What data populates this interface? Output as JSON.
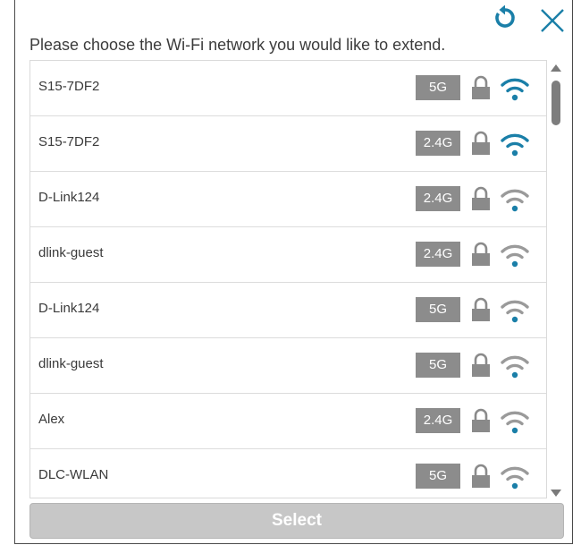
{
  "dialog": {
    "prompt": "Please choose the Wi-Fi network you would like to extend.",
    "select_label": "Select",
    "accent_color": "#1a7fa8",
    "weak_signal_color": "#9a9a9a",
    "band_badge_color": "#8c8c8c"
  },
  "networks": [
    {
      "ssid": "S15-7DF2",
      "band": "5G",
      "secured": true,
      "signal": "strong"
    },
    {
      "ssid": "S15-7DF2",
      "band": "2.4G",
      "secured": true,
      "signal": "strong"
    },
    {
      "ssid": "D-Link124",
      "band": "2.4G",
      "secured": true,
      "signal": "weak"
    },
    {
      "ssid": "dlink-guest",
      "band": "2.4G",
      "secured": true,
      "signal": "weak"
    },
    {
      "ssid": "D-Link124",
      "band": "5G",
      "secured": true,
      "signal": "weak"
    },
    {
      "ssid": "dlink-guest",
      "band": "5G",
      "secured": true,
      "signal": "weak"
    },
    {
      "ssid": "Alex",
      "band": "2.4G",
      "secured": true,
      "signal": "weak"
    },
    {
      "ssid": "DLC-WLAN",
      "band": "5G",
      "secured": true,
      "signal": "weak"
    }
  ],
  "icons": {
    "refresh": "refresh-icon",
    "close": "close-icon",
    "lock": "lock-icon",
    "wifi": "wifi-icon"
  }
}
